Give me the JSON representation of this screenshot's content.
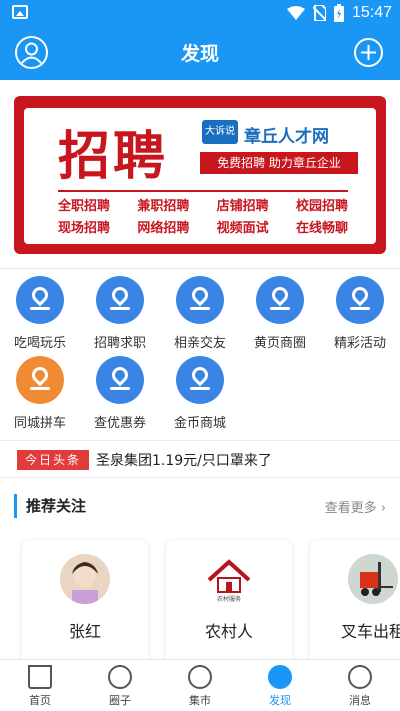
{
  "status_bar": {
    "time": "15:47",
    "battery_icon": "battery-icon",
    "wifi_icon": "wifi-icon"
  },
  "header": {
    "title": "发现"
  },
  "banner": {
    "big_text": "招聘",
    "logo_text": "大诉说",
    "site_name": "章丘人才网",
    "slogan": "免费招聘 助力章丘企业",
    "row1": [
      "全职招聘",
      "兼职招聘",
      "店铺招聘",
      "校园招聘"
    ],
    "row2": [
      "现场招聘",
      "网络招聘",
      "视频面试",
      "在线畅聊"
    ]
  },
  "grid": {
    "items": [
      {
        "label": "吃喝玩乐",
        "color": "#3a84e6"
      },
      {
        "label": "招聘求职",
        "color": "#3a84e6"
      },
      {
        "label": "相亲交友",
        "color": "#3a84e6"
      },
      {
        "label": "黄页商圈",
        "color": "#3a84e6"
      },
      {
        "label": "精彩活动",
        "color": "#3a84e6"
      },
      {
        "label": "同城拼车",
        "color": "#f08a33"
      },
      {
        "label": "查优惠券",
        "color": "#3a84e6"
      },
      {
        "label": "金币商城",
        "color": "#3a84e6"
      }
    ]
  },
  "headline": {
    "tag": "今日头条",
    "text": "圣泉集团1.19元/只口罩来了"
  },
  "recommend": {
    "title": "推荐关注",
    "more": "查看更多",
    "cards": [
      {
        "name": "张红"
      },
      {
        "name": "农村人"
      },
      {
        "name": "叉车出租"
      }
    ]
  },
  "tabbar": {
    "tabs": [
      {
        "label": "首页",
        "icon": "home-icon"
      },
      {
        "label": "圈子",
        "icon": "circle-icon"
      },
      {
        "label": "集市",
        "icon": "market-icon"
      },
      {
        "label": "发现",
        "icon": "discover-icon",
        "active": true
      },
      {
        "label": "消息",
        "icon": "message-icon"
      }
    ]
  }
}
